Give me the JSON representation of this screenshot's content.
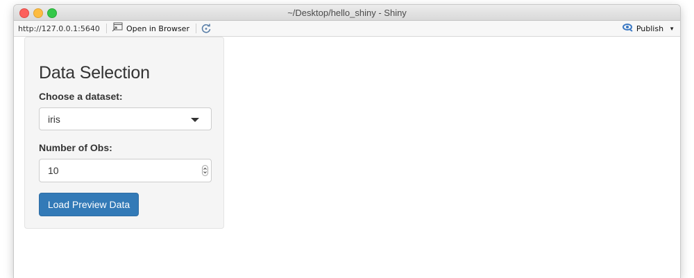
{
  "window": {
    "title": "~/Desktop/hello_shiny - Shiny"
  },
  "toolbar": {
    "url": "http://127.0.0.1:5640",
    "open_browser_label": "Open in Browser",
    "publish_label": "Publish"
  },
  "sidebar": {
    "heading": "Data Selection",
    "dataset": {
      "label": "Choose a dataset:",
      "value": "iris"
    },
    "obs": {
      "label": "Number of Obs:",
      "value": "10"
    },
    "load_button_label": "Load Preview Data"
  },
  "colors": {
    "button": "#337ab7",
    "well": "#f5f5f5",
    "publish_icon": "#3a78c3"
  },
  "icons": {
    "open_browser": "open-in-browser-icon",
    "refresh": "refresh-icon",
    "publish": "publish-icon",
    "dropdown": "caret-down-icon",
    "stepper": "number-stepper-icon"
  }
}
